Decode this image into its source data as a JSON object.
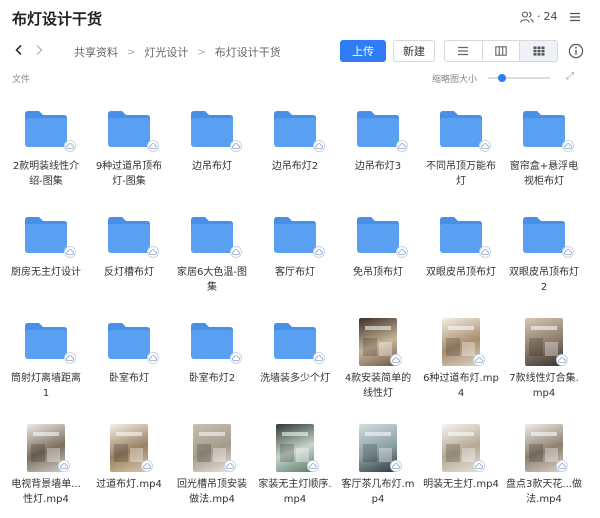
{
  "window": {
    "title": "布灯设计干货",
    "member_count": "24"
  },
  "toolbar": {
    "breadcrumb": [
      "共享资料",
      "灯光设计",
      "布灯设计干货"
    ],
    "upload_label": "上传",
    "new_label": "新建"
  },
  "subbar": {
    "files_label": "文件",
    "zoom_label": "缩略图大小"
  },
  "colors": {
    "accent": "#2f7cf6",
    "folder": "#5aa0f2",
    "folder_tab": "#4a8fe6"
  },
  "items": [
    {
      "name": "2款明装线性介绍-图集",
      "type": "folder"
    },
    {
      "name": "9种过道吊顶布灯-图集",
      "type": "folder"
    },
    {
      "name": "边吊布灯",
      "type": "folder"
    },
    {
      "name": "边吊布灯2",
      "type": "folder"
    },
    {
      "name": "边吊布灯3",
      "type": "folder"
    },
    {
      "name": "不同吊顶万能布灯",
      "type": "folder"
    },
    {
      "name": "窗帘盒+悬浮电视柜布灯",
      "type": "folder"
    },
    {
      "name": "厨房无主灯设计",
      "type": "folder"
    },
    {
      "name": "反灯槽布灯",
      "type": "folder"
    },
    {
      "name": "家居6大色温-图集",
      "type": "folder"
    },
    {
      "name": "客厅布灯",
      "type": "folder"
    },
    {
      "name": "免吊顶布灯",
      "type": "folder"
    },
    {
      "name": "双眼皮吊顶布灯",
      "type": "folder"
    },
    {
      "name": "双眼皮吊顶布灯2",
      "type": "folder"
    },
    {
      "name": "筒射灯离墙距离1",
      "type": "folder"
    },
    {
      "name": "卧室布灯",
      "type": "folder"
    },
    {
      "name": "卧室布灯2",
      "type": "folder"
    },
    {
      "name": "洗墙装多少个灯",
      "type": "folder"
    },
    {
      "name": "4款安装简单的线性灯",
      "type": "video"
    },
    {
      "name": "6种过道布灯.mp4",
      "type": "video"
    },
    {
      "name": "7款线性灯合集.mp4",
      "type": "video"
    },
    {
      "name": "电视背景墙单...性灯.mp4",
      "type": "video"
    },
    {
      "name": "过道布灯.mp4",
      "type": "video"
    },
    {
      "name": "回光槽吊顶安装做法.mp4",
      "type": "video"
    },
    {
      "name": "家装无主灯顺序.mp4",
      "type": "video"
    },
    {
      "name": "客厅茶几布灯.mp4",
      "type": "video"
    },
    {
      "name": "明装无主灯.mp4",
      "type": "video"
    },
    {
      "name": "盘点3款天花...做法.mp4",
      "type": "video"
    }
  ]
}
